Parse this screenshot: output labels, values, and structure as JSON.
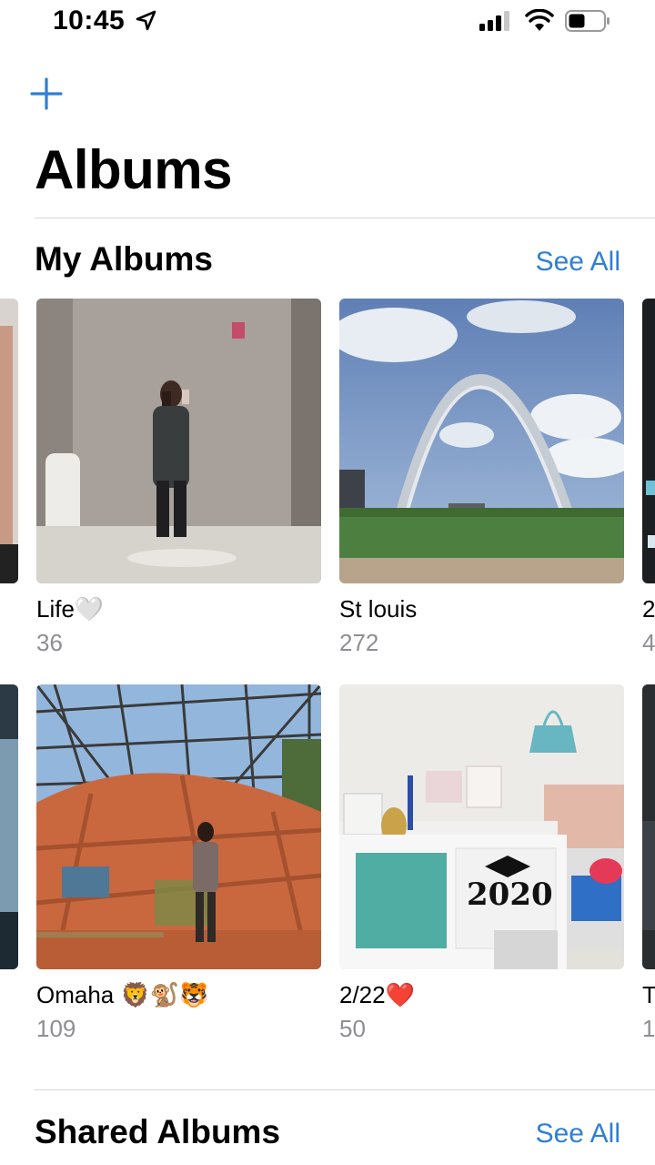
{
  "status_bar": {
    "time": "10:45"
  },
  "header": {
    "title": "Albums"
  },
  "my_albums": {
    "title": "My Albums",
    "see_all": "See All",
    "albums": [
      {
        "name": "Life🤍",
        "count": "36"
      },
      {
        "name": "St louis",
        "count": "272"
      },
      {
        "name": "Omaha 🦁🐒🐯",
        "count": "109"
      },
      {
        "name": "2/22❤️",
        "count": "50"
      }
    ],
    "partial_right": [
      {
        "name": "2",
        "count": "4"
      },
      {
        "name": "T",
        "count": "1"
      }
    ]
  },
  "shared_albums": {
    "title": "Shared Albums",
    "see_all": "See All"
  }
}
